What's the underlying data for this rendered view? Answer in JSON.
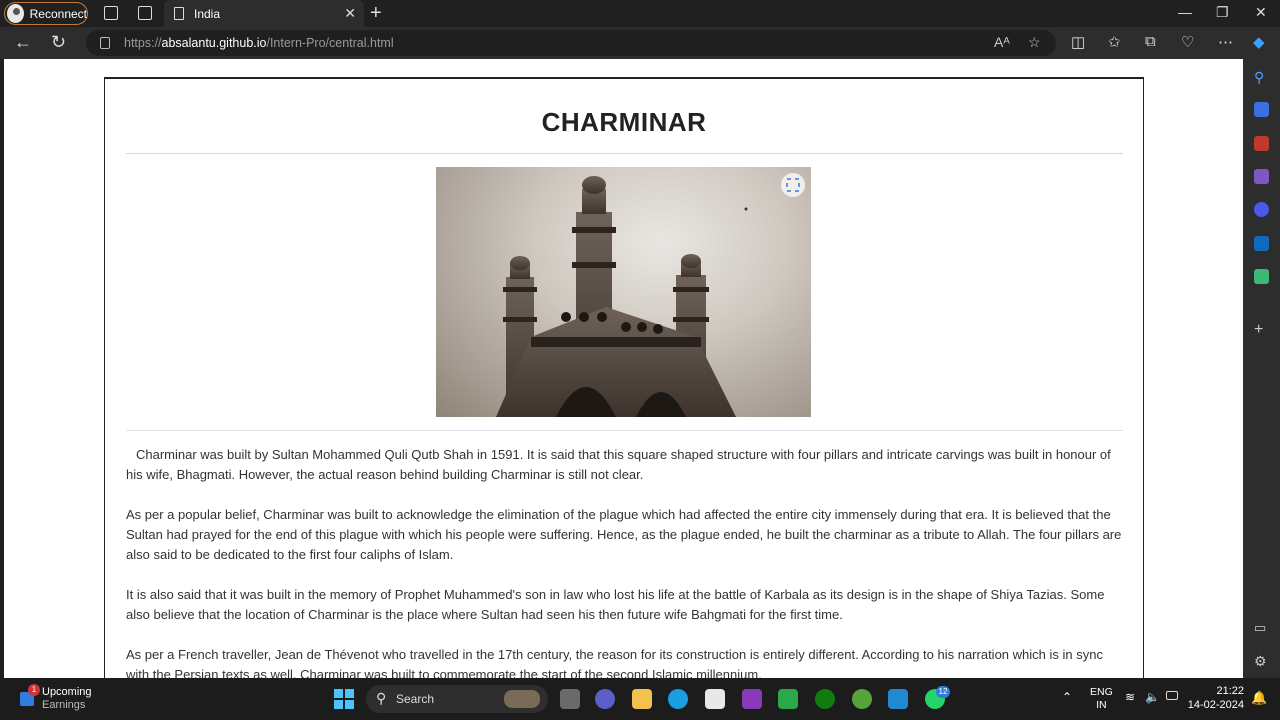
{
  "browser": {
    "profile_button": "Reconnect",
    "tab_title": "India",
    "url_prefix": "https://",
    "url_domain": "absalantu.github.io",
    "url_path": "/Intern-Pro/central.html"
  },
  "page": {
    "title": "CHARMINAR",
    "paragraphs": [
      "Charminar was built by Sultan Mohammed Quli Qutb Shah in 1591. It is said that this square shaped structure with four pillars and intricate carvings was built in honour of his wife, Bhagmati. However, the actual reason behind building Charminar is still not clear.",
      "As per a popular belief, Charminar was built to acknowledge the elimination of the plague which had affected the entire city immensely during that era. It is believed that the Sultan had prayed for the end of this plague with which his people were suffering. Hence, as the plague ended, he built the charminar as a tribute to Allah. The four pillars are also said to be dedicated to the first four caliphs of Islam.",
      "It is also said that it was built in the memory of Prophet Muhammed's son in law who lost his life at the battle of Karbala as its design is in the shape of Shiya Tazias. Some also believe that the location of Charminar is the place where Sultan had seen his then future wife Bahgmati for the first time.",
      "As per a French traveller, Jean de Thévenot who travelled in the 17th century, the reason for its construction is entirely different. According to his narration which is in sync with the Persian texts as well, Charminar was built to commemorate the start of the second Islamic millennium."
    ]
  },
  "taskbar": {
    "widget_title": "Upcoming",
    "widget_subtitle": "Earnings",
    "widget_badge": "1",
    "search_label": "Search",
    "whatsapp_badge": "12",
    "lang_top": "ENG",
    "lang_bottom": "IN",
    "time": "21:22",
    "date": "14-02-2024"
  },
  "colors": {
    "accent_blue": "#0067c0",
    "reconnect_border": "#c27a3a"
  }
}
